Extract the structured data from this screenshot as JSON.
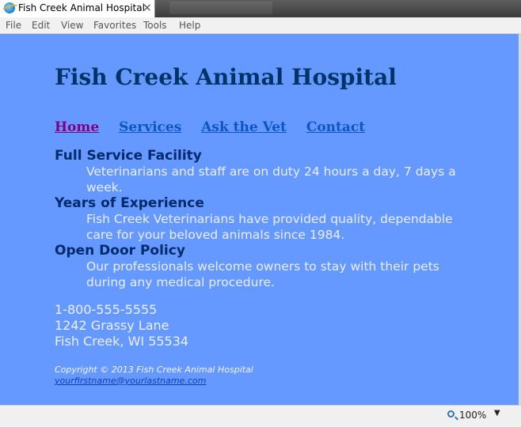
{
  "browser": {
    "tab_title": "Fish Creek Animal Hospital",
    "close_glyph": "×",
    "menu": [
      "File",
      "Edit",
      "View",
      "Favorites",
      "Tools",
      "Help"
    ],
    "zoom": "100%",
    "zoom_dropdown": "▼"
  },
  "site": {
    "title": "Fish Creek Animal Hospital",
    "nav": [
      "Home",
      "Services",
      "Ask the Vet",
      "Contact"
    ],
    "features": [
      {
        "title": "Full Service Facility",
        "desc": "Veterinarians and staff are on duty 24 hours a day, 7 days a week."
      },
      {
        "title": "Years of Experience",
        "desc": "Fish Creek Veterinarians have provided quality, dependable care for your beloved animals since 1984."
      },
      {
        "title": "Open Door Policy",
        "desc": "Our professionals welcome owners to stay with their pets during any medical procedure."
      }
    ],
    "contact": {
      "phone": "1-800-555-5555",
      "street": "1242 Grassy Lane",
      "city": "Fish Creek, WI 55534"
    },
    "footer": {
      "copyright": "Copyright © 2013 Fish Creek Animal Hospital",
      "email": "yourfirstname@yourlastname.com"
    }
  },
  "colors": {
    "page_background": "#6699ff",
    "heading": "#003366",
    "visited_link": "#800080",
    "link": "#0b55c8"
  }
}
